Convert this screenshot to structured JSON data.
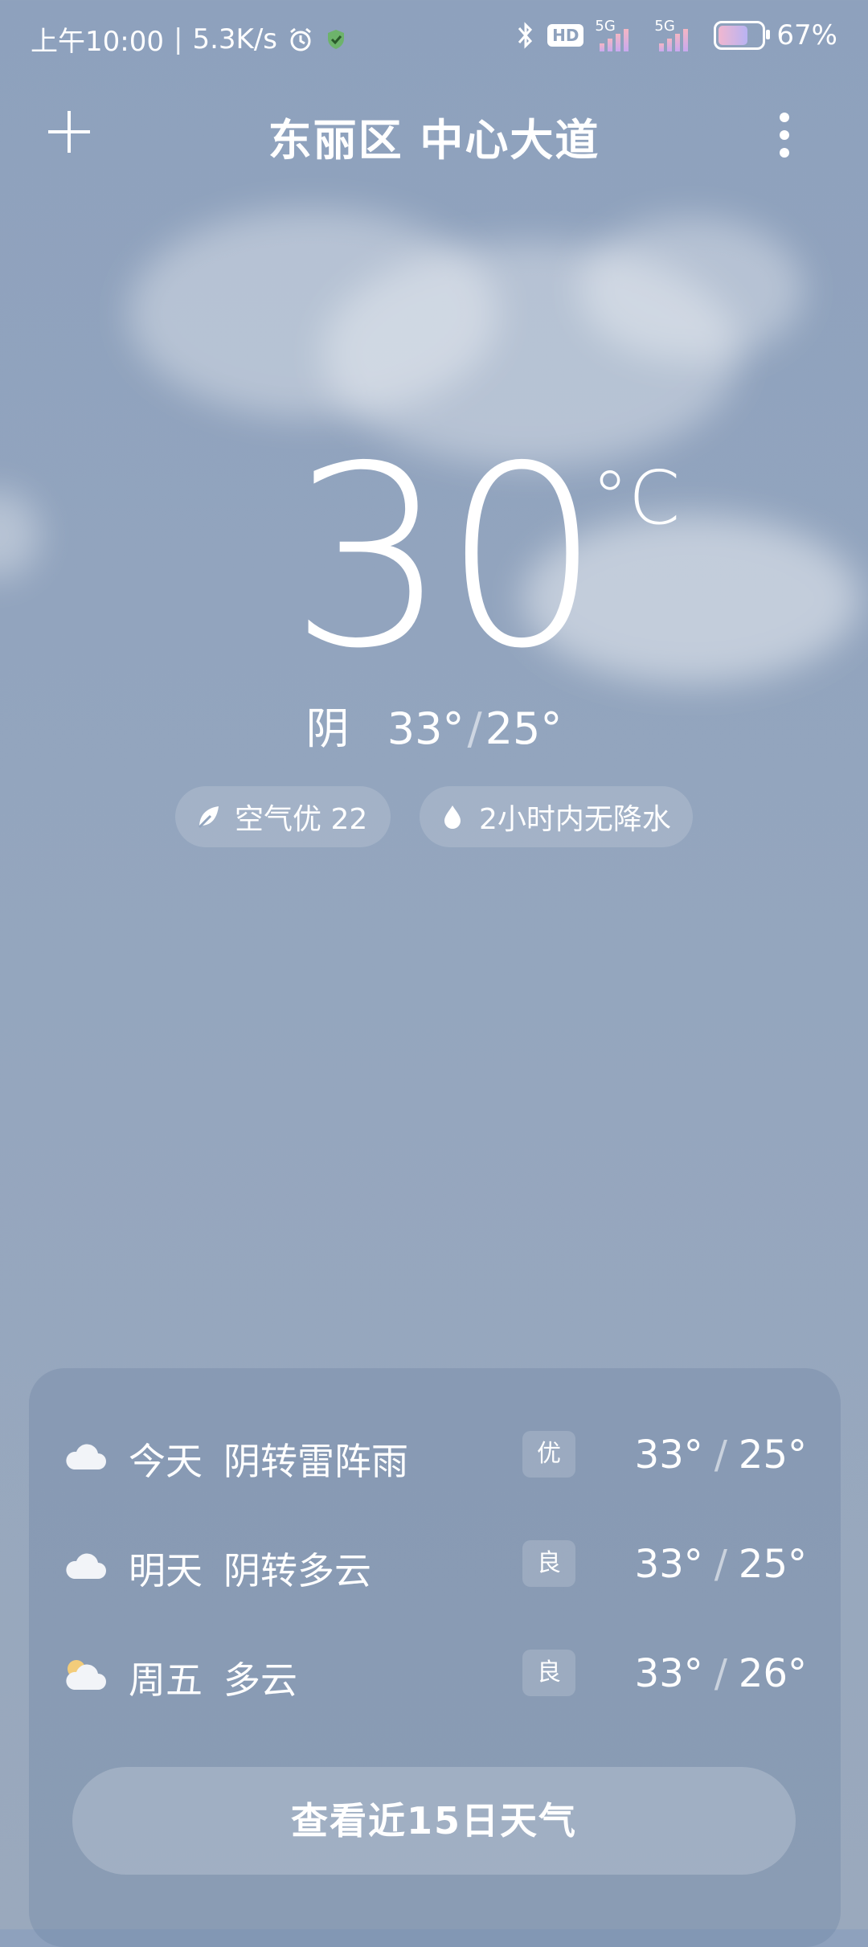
{
  "status_bar": {
    "time": "上午10:00",
    "net_speed": "5.3K/s",
    "hd": "HD",
    "net1": "5G",
    "net2": "5G",
    "battery": "67%",
    "icons": [
      "alarm-icon",
      "security-icon",
      "bluetooth-icon",
      "signal-icon",
      "battery-icon"
    ]
  },
  "header": {
    "location": "东丽区 中心大道"
  },
  "current": {
    "temperature": "30",
    "unit": "°C",
    "condition": "阴",
    "high": "33°",
    "low": "25°",
    "slash": "/"
  },
  "chips": {
    "air": {
      "label": "空气优 22",
      "icon": "leaf-icon"
    },
    "rain": {
      "label": "2小时内无降水",
      "icon": "water-drop-icon"
    }
  },
  "forecast": [
    {
      "day": "今天",
      "desc": "阴转雷阵雨",
      "aqi": "优",
      "high": "33°",
      "low": "25°",
      "icon": "cloud-icon"
    },
    {
      "day": "明天",
      "desc": "阴转多云",
      "aqi": "良",
      "high": "33°",
      "low": "25°",
      "icon": "cloud-icon"
    },
    {
      "day": "周五",
      "desc": "多云",
      "aqi": "良",
      "high": "33°",
      "low": "26°",
      "icon": "partly-cloudy-icon"
    }
  ],
  "forecast_button": "查看近15日天气",
  "colors": {
    "background": "#8ea1bd",
    "text": "#ffffff",
    "sun": "#f3cc7a"
  }
}
